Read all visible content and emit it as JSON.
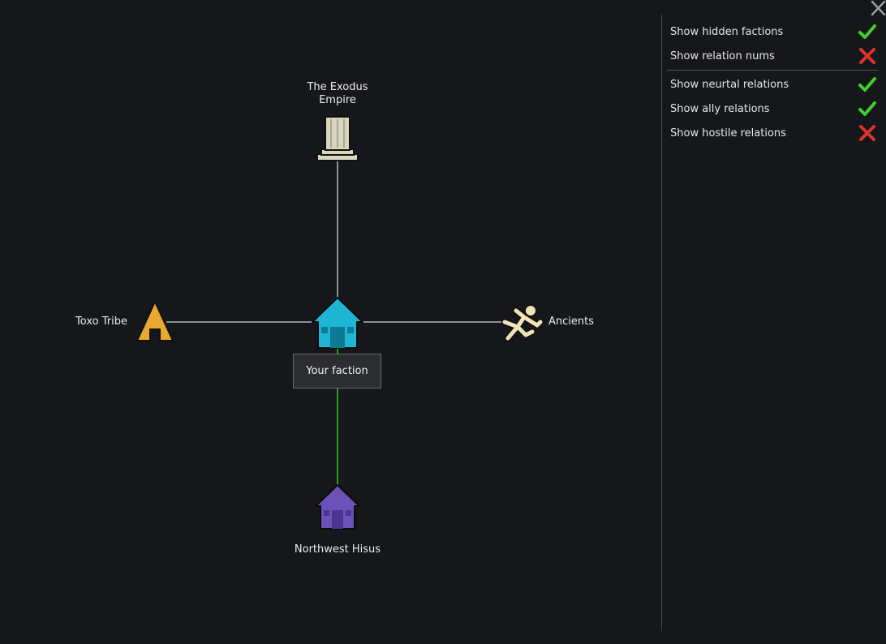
{
  "factions": {
    "player": {
      "name": "Your faction",
      "icon": "house-icon",
      "color": "#1fb6d6"
    },
    "exodus": {
      "name": "The Exodus Empire",
      "name_line1": "The Exodus",
      "name_line2": "Empire",
      "icon": "pillar-icon",
      "color": "#d8d6bf"
    },
    "toxo": {
      "name": "Toxo Tribe",
      "icon": "tent-icon",
      "color": "#e8a92e"
    },
    "ancients": {
      "name": "Ancients",
      "icon": "falling-person-icon",
      "color": "#efe4b8"
    },
    "northwest": {
      "name": "Northwest Hisus",
      "icon": "house-icon",
      "color": "#6a52b8"
    }
  },
  "relations": [
    {
      "from": "player",
      "to": "exodus",
      "type": "neutral"
    },
    {
      "from": "player",
      "to": "toxo",
      "type": "neutral"
    },
    {
      "from": "player",
      "to": "ancients",
      "type": "neutral"
    },
    {
      "from": "player",
      "to": "northwest",
      "type": "ally"
    }
  ],
  "relation_colors": {
    "neutral": "#8c8f94",
    "ally": "#1fa31f"
  },
  "tooltip": {
    "text": "Your faction"
  },
  "options": [
    {
      "label": "Show hidden factions",
      "checked": true
    },
    {
      "label": "Show relation nums",
      "checked": false
    },
    {
      "label": "Show neurtal relations",
      "checked": true
    },
    {
      "label": "Show ally relations",
      "checked": true
    },
    {
      "label": "Show hostile relations",
      "checked": false
    }
  ],
  "check_colors": {
    "on": "#3ed12b",
    "off": "#e0322c"
  },
  "close_icon": "close-icon"
}
